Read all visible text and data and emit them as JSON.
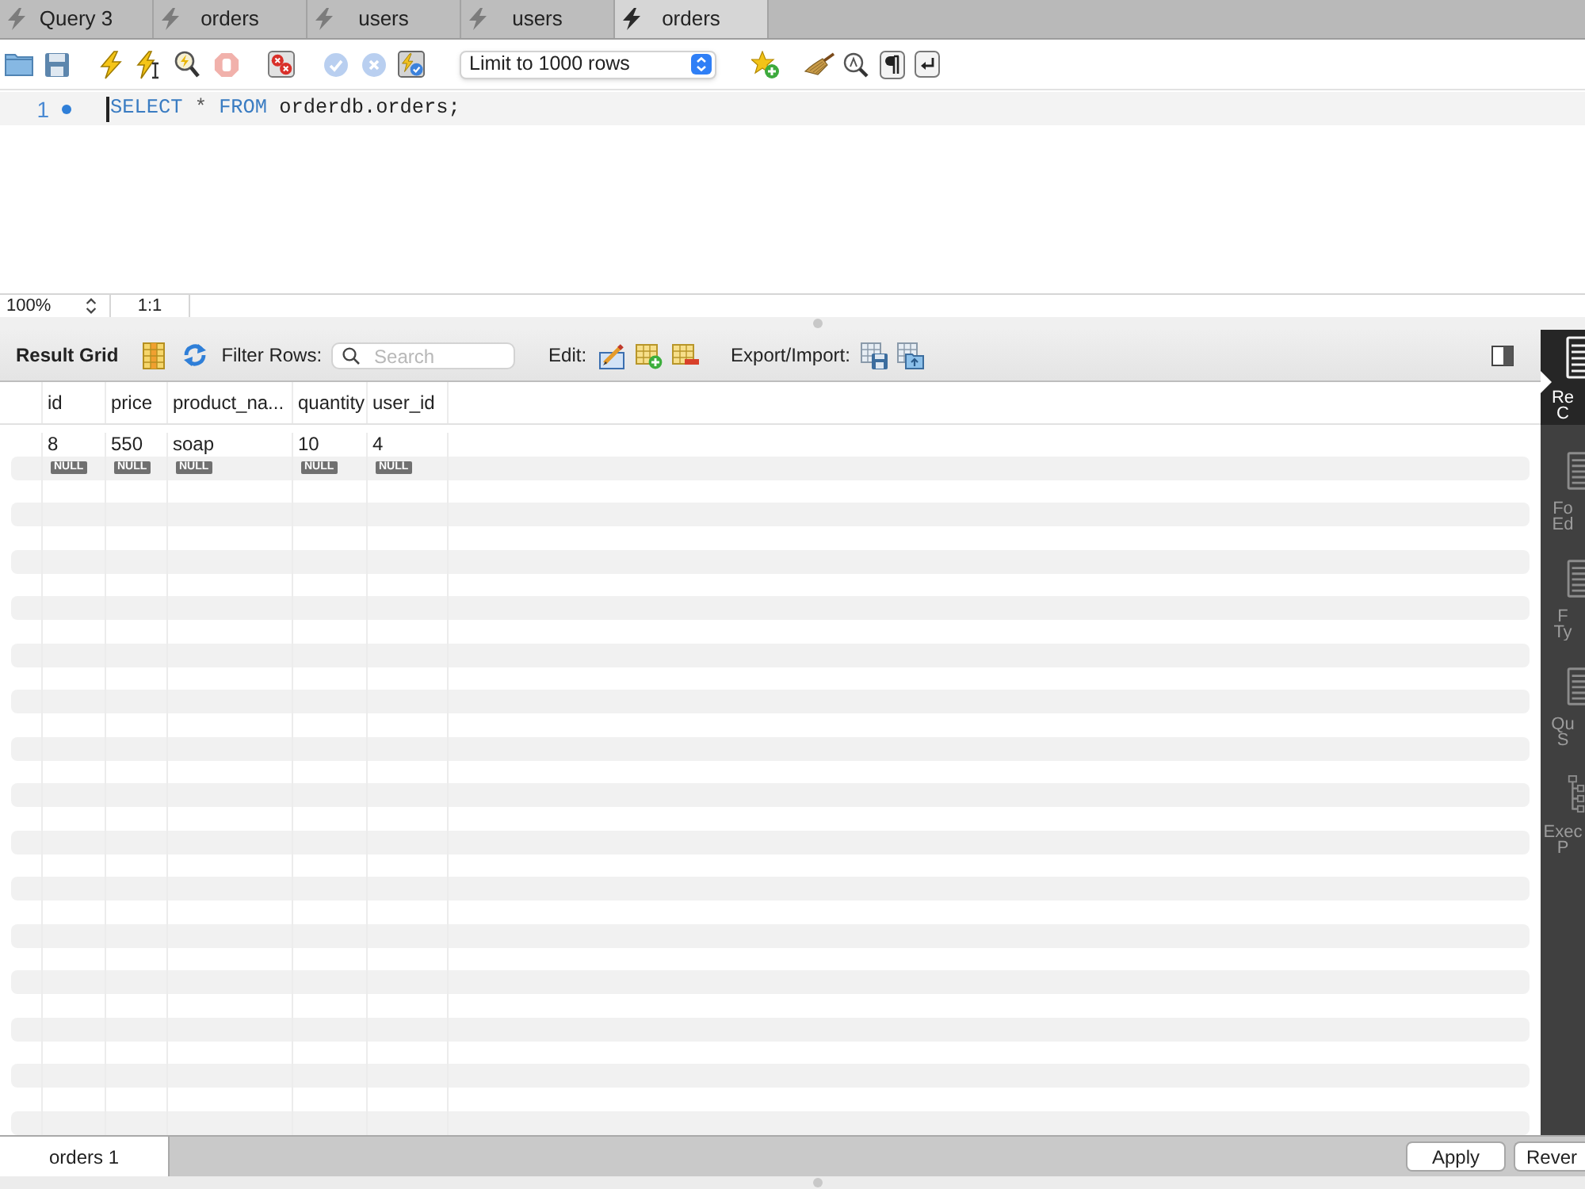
{
  "tabs": [
    {
      "label": "Query 3",
      "selected": false
    },
    {
      "label": "orders",
      "selected": false
    },
    {
      "label": "users",
      "selected": false
    },
    {
      "label": "users",
      "selected": false
    },
    {
      "label": "orders",
      "selected": true
    }
  ],
  "toolbar": {
    "stop": {
      "disabled": true
    },
    "commit": {
      "disabled": true
    },
    "rollback": {
      "disabled": true
    },
    "limit": "Limit to 1000 rows"
  },
  "editor": {
    "lines": [
      {
        "number": "1",
        "current": true,
        "marker": true,
        "tokens": [
          {
            "text": "SELECT",
            "kind": "keyword"
          },
          {
            "text": "*",
            "kind": "operator"
          },
          {
            "text": "FROM",
            "kind": "keyword"
          },
          {
            "text": "orderdb.orders;",
            "kind": "identifier"
          }
        ]
      }
    ],
    "zoom": "100%",
    "position": "1:1"
  },
  "result": {
    "title": "Result Grid",
    "filter_label": "Filter Rows:",
    "search_placeholder": "Search",
    "edit_label": "Edit:",
    "export_label": "Export/Import:"
  },
  "table": {
    "columns": [
      "id",
      "price",
      "product_na...",
      "quantity",
      "user_id"
    ],
    "rows": [
      {
        "kind": "values",
        "cells": [
          "8",
          "550",
          "soap",
          "10",
          "4"
        ]
      },
      {
        "kind": "null",
        "cells": [
          "NULL",
          "NULL",
          "NULL",
          "NULL",
          "NULL"
        ]
      }
    ]
  },
  "side_panel": {
    "items": [
      {
        "kind": "document",
        "lines": [
          "Re",
          "C"
        ],
        "selected": true
      },
      {
        "kind": "document",
        "lines": [
          "Fo",
          "Ed"
        ],
        "selected": false
      },
      {
        "kind": "document",
        "lines": [
          "F",
          "Ty"
        ],
        "selected": false
      },
      {
        "kind": "document",
        "lines": [
          "Qu",
          "S"
        ],
        "selected": false
      },
      {
        "kind": "tree",
        "lines": [
          "Exec",
          "P"
        ],
        "selected": false
      }
    ]
  },
  "bottom": {
    "result_tabs": [
      {
        "label": "orders 1",
        "selected": true
      }
    ],
    "buttons": [
      "Apply",
      "Rever"
    ]
  }
}
